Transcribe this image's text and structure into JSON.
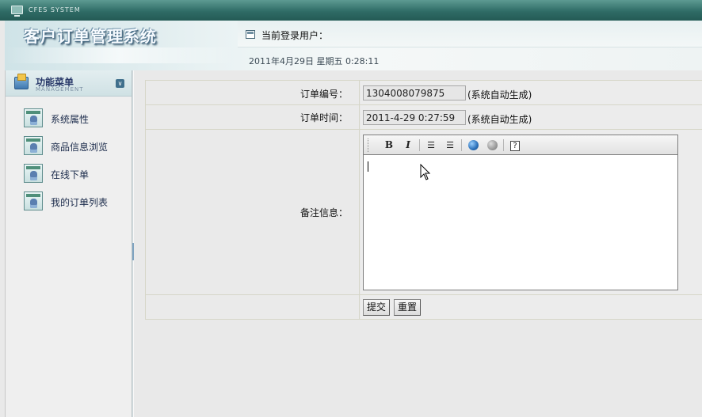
{
  "system": {
    "title": "CFES SYSTEM"
  },
  "header": {
    "app_title": "客户订单管理系统",
    "current_user_label": "当前登录用户：",
    "datetime": "2011年4月29日  星期五  0:28:11"
  },
  "sidebar": {
    "title": "功能菜单",
    "subtitle": "MANAGEMENT",
    "items": [
      {
        "label": "系统属性"
      },
      {
        "label": "商品信息浏览"
      },
      {
        "label": "在线下单"
      },
      {
        "label": "我的订单列表"
      }
    ]
  },
  "form": {
    "order_no": {
      "label": "订单编号：",
      "value": "1304008079875",
      "hint": "(系统自动生成)"
    },
    "order_time": {
      "label": "订单时间：",
      "value": "2011-4-29 0:27:59",
      "hint": "(系统自动生成)"
    },
    "remark": {
      "label": "备注信息：",
      "toolbar": {
        "bold": "B",
        "italic": "I",
        "help": "?"
      }
    },
    "submit_label": "提交",
    "reset_label": "重置"
  }
}
